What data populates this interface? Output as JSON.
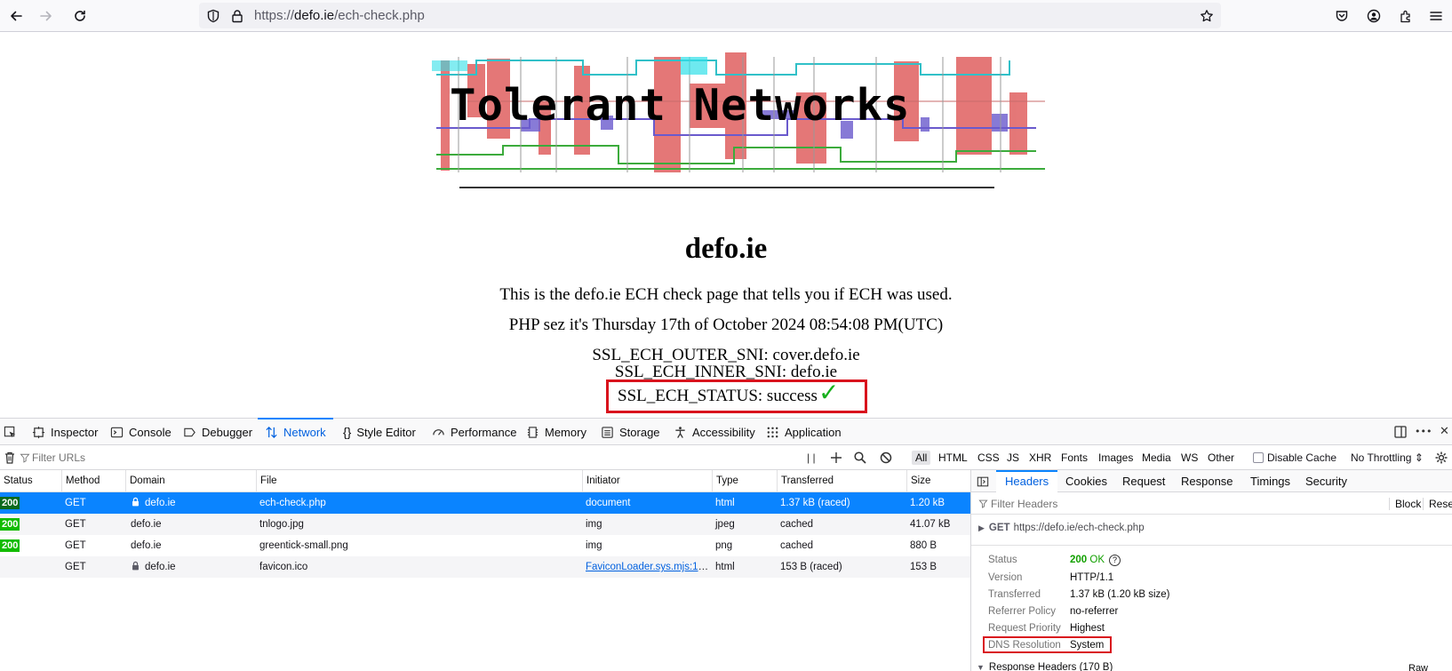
{
  "browser": {
    "url_scheme": "https://",
    "url_host": "defo.ie",
    "url_path": "/ech-check.php",
    "icons": [
      "back-icon",
      "forward-icon",
      "reload-icon",
      "shield-icon",
      "lock-icon",
      "star-icon",
      "pocket-icon",
      "account-icon",
      "extensions-icon",
      "menu-icon"
    ]
  },
  "page": {
    "logo_text": "Tolerant Networks",
    "site_title": "defo.ie",
    "intro": "This is the defo.ie ECH check page that tells you if ECH was used.",
    "php_time": "PHP sez it's Thursday 17th of October 2024 08:54:08 PM(UTC)",
    "outer_sni": "SSL_ECH_OUTER_SNI: cover.defo.ie",
    "inner_sni": "SSL_ECH_INNER_SNI: defo.ie",
    "ech_status": "SSL_ECH_STATUS: success",
    "tick": "✓",
    "highlight_color": "#d9131d"
  },
  "devtools": {
    "tabs": [
      "Inspector",
      "Console",
      "Debugger",
      "Network",
      "Style Editor",
      "Performance",
      "Memory",
      "Storage",
      "Accessibility",
      "Application"
    ],
    "active_tab": "Network",
    "filter_placeholder": "Filter URLs",
    "pause": "| |",
    "type_filters": [
      "All",
      "HTML",
      "CSS",
      "JS",
      "XHR",
      "Fonts",
      "Images",
      "Media",
      "WS",
      "Other"
    ],
    "disable_cache": "Disable Cache",
    "throttling": "No Throttling ⇕",
    "accent": "#0a84ff",
    "more": "•••",
    "close": "✕"
  },
  "requests": {
    "columns": [
      "Status",
      "Method",
      "Domain",
      "File",
      "Initiator",
      "Type",
      "Transferred",
      "Size"
    ],
    "rows": [
      {
        "status": "200",
        "method": "GET",
        "domain": "defo.ie",
        "secure": true,
        "file": "ech-check.php",
        "initiator": "document",
        "type": "html",
        "transferred": "1.37 kB (raced)",
        "size": "1.20 kB"
      },
      {
        "status": "200",
        "method": "GET",
        "domain": "defo.ie",
        "secure": false,
        "file": "tnlogo.jpg",
        "initiator": "img",
        "type": "jpeg",
        "transferred": "cached",
        "size": "41.07 kB"
      },
      {
        "status": "200",
        "method": "GET",
        "domain": "defo.ie",
        "secure": false,
        "file": "greentick-small.png",
        "initiator": "img",
        "type": "png",
        "transferred": "cached",
        "size": "880 B"
      },
      {
        "status": "",
        "method": "GET",
        "domain": "defo.ie",
        "secure": true,
        "file": "favicon.ico",
        "initiator": "FaviconLoader.sys.mjs:17…",
        "type": "html",
        "transferred": "153 B (raced)",
        "size": "153 B"
      }
    ]
  },
  "details": {
    "tabs": [
      "Headers",
      "Cookies",
      "Request",
      "Response",
      "Timings",
      "Security"
    ],
    "active_tab": "Headers",
    "filter_placeholder": "Filter Headers",
    "block": "Block",
    "resend": "Resend",
    "summary_method": "GET",
    "summary_url": "https://defo.ie/ech-check.php",
    "fields": [
      {
        "key": "Status",
        "value": "200",
        "extra": "OK"
      },
      {
        "key": "Version",
        "value": "HTTP/1.1"
      },
      {
        "key": "Transferred",
        "value": "1.37 kB (1.20 kB size)"
      },
      {
        "key": "Referrer Policy",
        "value": "no-referrer"
      },
      {
        "key": "Request Priority",
        "value": "Highest"
      },
      {
        "key": "DNS Resolution",
        "value": "System"
      }
    ],
    "response_headers": "Response Headers (170 B)",
    "raw": "Raw"
  }
}
